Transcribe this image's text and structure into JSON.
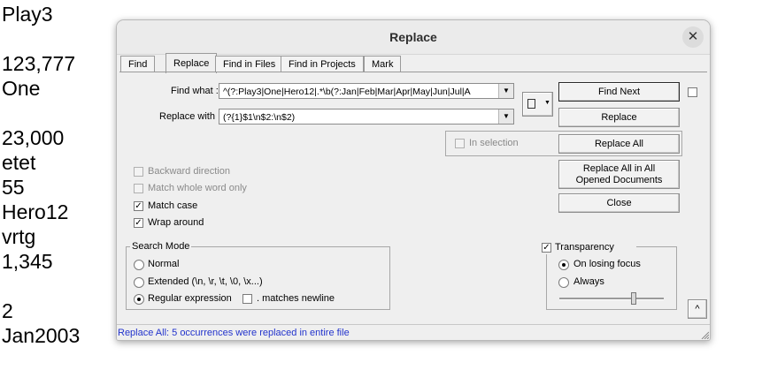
{
  "document": {
    "lines": [
      "Play3",
      "",
      "123,777",
      "One",
      "",
      "23,000",
      "etet",
      "55",
      "Hero12",
      "vrtg",
      "1,345",
      "",
      "2",
      "Jan2003"
    ]
  },
  "dialog": {
    "title": "Replace",
    "close_glyph": "✕",
    "tabs": [
      "Find",
      "Replace",
      "Find in Files",
      "Find in Projects",
      "Mark"
    ],
    "active_tab": "Replace",
    "find_label": "Find what :",
    "find_value": "^(?:Play3|One|Hero12|.*\\b(?:Jan|Feb|Mar|Apr|May|Jun|Jul|A",
    "replace_label": "Replace with :",
    "replace_value": "(?{1}$1\\n$2:\\n$2)",
    "in_selection_label": "In selection",
    "buttons": {
      "find_next": "Find Next",
      "replace": "Replace",
      "replace_all": "Replace All",
      "replace_all_docs_line1": "Replace All in All",
      "replace_all_docs_line2": "Opened Documents",
      "close": "Close",
      "collapse": "^"
    },
    "options": {
      "backward": "Backward direction",
      "whole_word": "Match whole word only",
      "match_case": "Match case",
      "wrap_around": "Wrap around"
    },
    "search_mode": {
      "title": "Search Mode",
      "normal": "Normal",
      "extended": "Extended (\\n, \\r, \\t, \\0, \\x...)",
      "regex": "Regular expression",
      "dot_newline": ". matches newline"
    },
    "transparency": {
      "title": "Transparency",
      "on_losing_focus": "On losing focus",
      "always": "Always",
      "slider_level": 0.72
    },
    "status": "Replace All: 5 occurrences were replaced in entire file",
    "dropdown_glyph": "▼"
  }
}
